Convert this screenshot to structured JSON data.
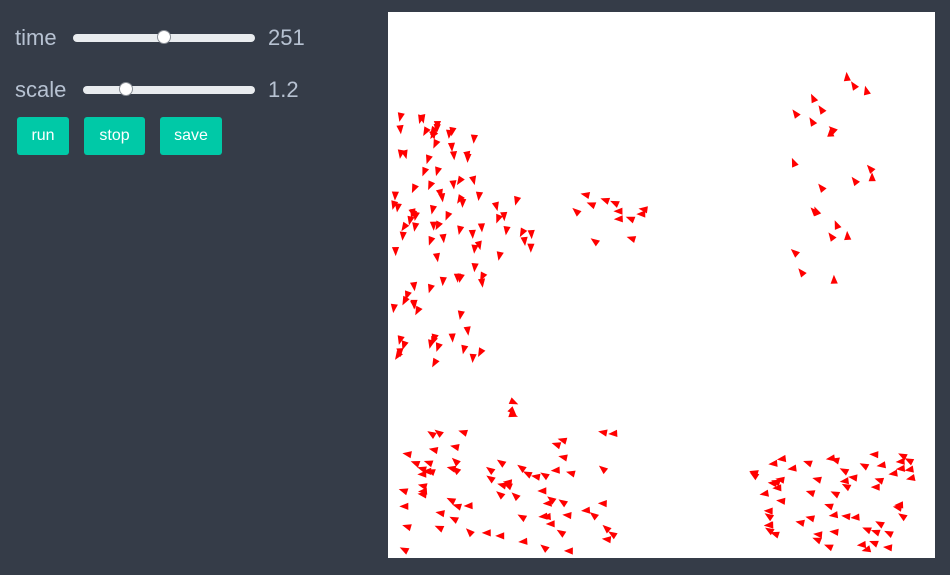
{
  "controls": {
    "time": {
      "label": "time",
      "value": "251",
      "fraction": 0.5
    },
    "scale": {
      "label": "scale",
      "value": "1.2",
      "fraction": 0.25
    }
  },
  "buttons": {
    "run": "run",
    "stop": "stop",
    "save": "save"
  },
  "colors": {
    "background": "#353c48",
    "label_text": "#b7c2d2",
    "button": "#00c9a7",
    "button_text": "#ffffff",
    "canvas": "#ffffff",
    "agent": "#ff0000"
  }
}
